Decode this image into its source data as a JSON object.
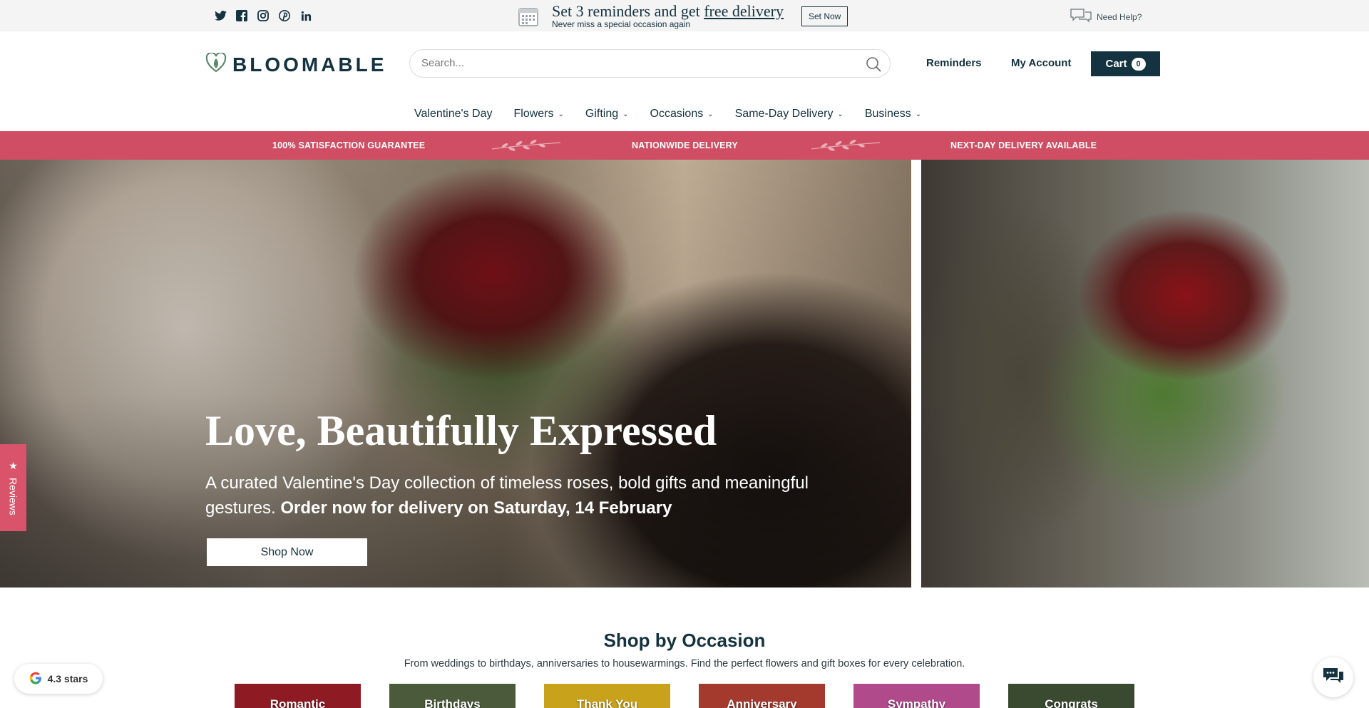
{
  "topbar": {
    "social": [
      "twitter-icon",
      "facebook-icon",
      "instagram-icon",
      "pinterest-icon",
      "linkedin-icon"
    ],
    "promo_head_prefix": "Set 3 reminders and get ",
    "promo_head_link": "free delivery",
    "promo_sub": "Never miss a special occasion again",
    "set_now_label": "Set Now",
    "help_label": "Need Help?"
  },
  "header": {
    "logo_text": "BLOOMABLE",
    "search_placeholder": "Search...",
    "reminders_label": "Reminders",
    "account_label": "My Account",
    "cart_label": "Cart",
    "cart_count": "0"
  },
  "nav": {
    "items": [
      {
        "label": "Valentine's Day",
        "dropdown": false
      },
      {
        "label": "Flowers",
        "dropdown": true
      },
      {
        "label": "Gifting",
        "dropdown": true
      },
      {
        "label": "Occasions",
        "dropdown": true
      },
      {
        "label": "Same-Day Delivery",
        "dropdown": true
      },
      {
        "label": "Business",
        "dropdown": true
      }
    ]
  },
  "strip": {
    "items": [
      "100% SATISFACTION GUARANTEE",
      "NATIONWIDE DELIVERY",
      "NEXT-DAY DELIVERY AVAILABLE"
    ]
  },
  "hero": {
    "title": "Love, Beautifully Expressed",
    "subtitle": "A curated Valentine's Day collection of timeless roses, bold gifts and meaningful gestures. ",
    "subtitle_bold": "Order now for delivery on Saturday, 14 February",
    "cta_label": "Shop Now"
  },
  "reviews_tab": {
    "label": "Reviews"
  },
  "occasions": {
    "title": "Shop by Occasion",
    "subtitle": "From weddings to birthdays, anniversaries to housewarmings. Find the perfect flowers and gift boxes for every celebration.",
    "tiles": [
      {
        "label": "Romantic",
        "color": "#8e1a24"
      },
      {
        "label": "Birthdays",
        "color": "#4a5a3a"
      },
      {
        "label": "Thank You",
        "color": "#c9a21c"
      },
      {
        "label": "Anniversary",
        "color": "#a43a2e"
      },
      {
        "label": "Sympathy",
        "color": "#b04a8a"
      },
      {
        "label": "Congrats",
        "color": "#3a4a30"
      }
    ]
  },
  "rating": {
    "label": "4.3 stars"
  },
  "colors": {
    "brand": "#14323f",
    "accent": "#cf4e63"
  }
}
